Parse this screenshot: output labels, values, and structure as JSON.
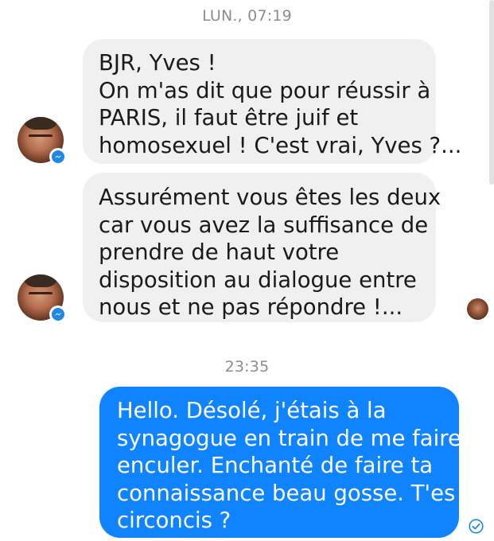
{
  "thread": {
    "timestamp_1": "LUN., 07:19",
    "timestamp_2": "23:35",
    "messages": [
      {
        "direction": "incoming",
        "lines": [
          "BJR, Yves !",
          "On m'as dit que pour réussir à",
          "PARIS, il faut être juif et",
          "homosexuel ! C'est vrai, Yves ?..."
        ]
      },
      {
        "direction": "incoming",
        "lines": [
          "Assurément vous êtes les deux",
          "car vous avez la suffisance de",
          "prendre de haut votre",
          "disposition au dialogue entre",
          "nous et ne pas répondre !..."
        ]
      },
      {
        "direction": "outgoing",
        "lines": [
          "Hello. Désolé, j'étais à la",
          "synagogue en train de me faire",
          "enculer. Enchanté de faire ta",
          "connaissance beau gosse. T'es",
          "circoncis ?"
        ]
      }
    ]
  },
  "icons": {
    "contact_avatar": "avatar",
    "messenger_badge": "messenger-badge-icon",
    "seen_indicator": "seen-avatar",
    "delivered": "check-circle-icon"
  },
  "colors": {
    "incoming_bubble": "#f0f0f0",
    "outgoing_bubble": "#0f84fe",
    "timestamp_text": "#8d8d8d"
  }
}
